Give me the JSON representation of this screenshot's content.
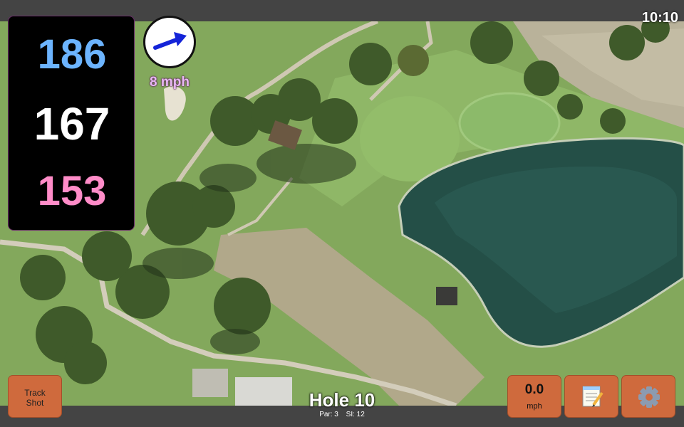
{
  "status": {
    "time": "10:10"
  },
  "distances": {
    "back": "186",
    "middle": "167",
    "front": "153"
  },
  "wind": {
    "speed": "8 mph",
    "icon": "wind-direction-arrow-icon"
  },
  "buttons": {
    "track_shot": {
      "line1": "Track",
      "line2": "Shot"
    },
    "speed": {
      "value": "0.0",
      "unit": "mph"
    },
    "notes": {
      "icon": "notepad-icon"
    },
    "settings": {
      "icon": "gear-icon"
    }
  },
  "hole": {
    "title": "Hole 10",
    "par": "Par: 3",
    "stroke_index": "SI: 12"
  },
  "colors": {
    "back_distance": "#6cb4ff",
    "middle_distance": "#ffffff",
    "front_distance": "#ff8cc8",
    "button": "#cf6a3d",
    "wind_arrow": "#1424d8"
  }
}
